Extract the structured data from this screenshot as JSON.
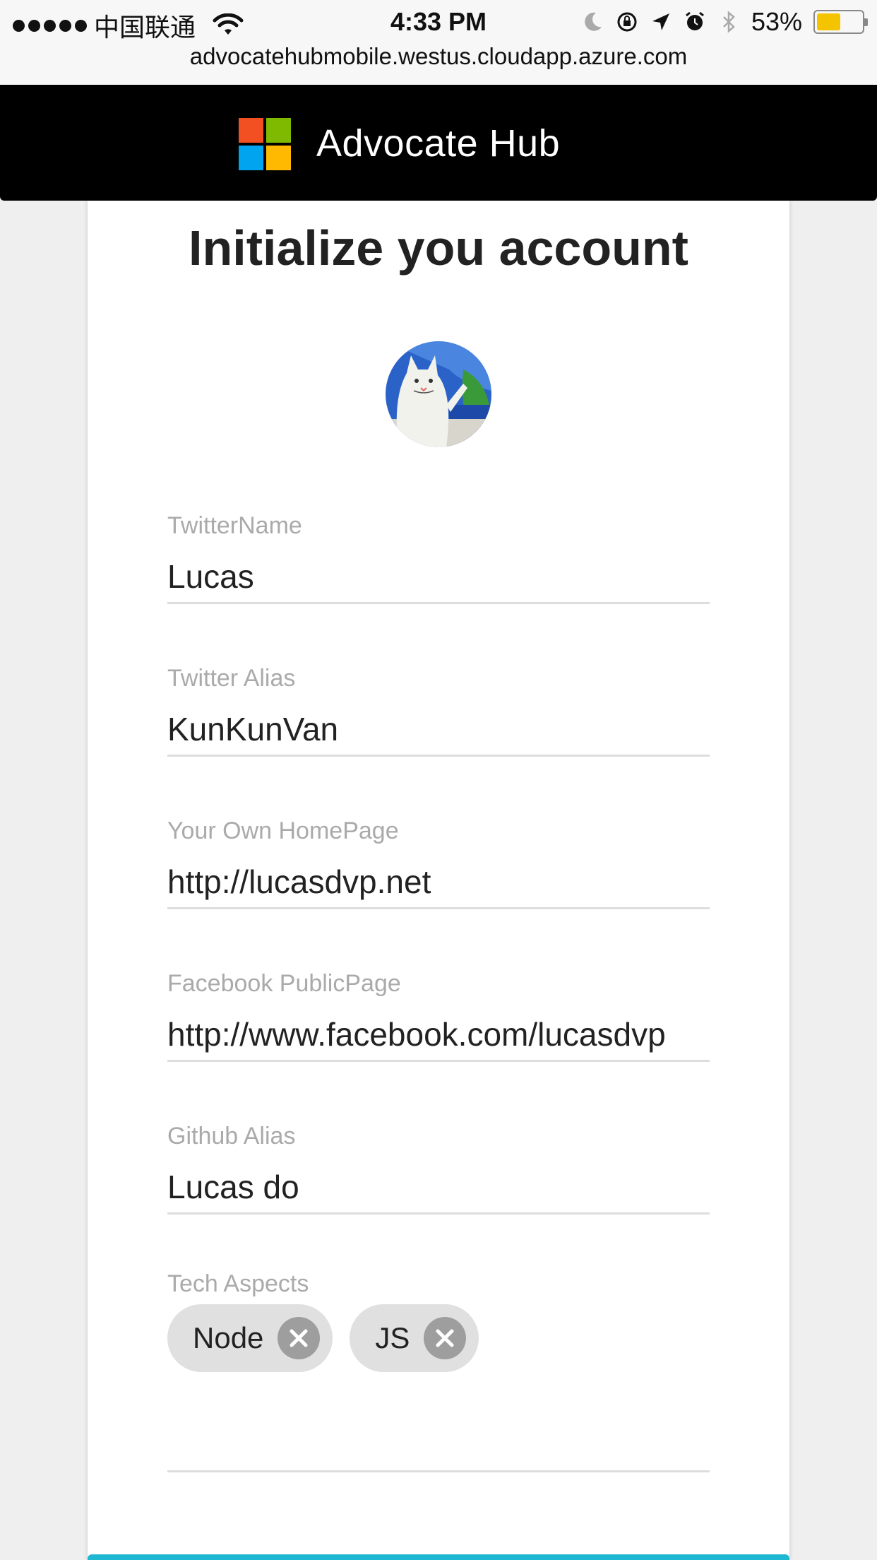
{
  "status_bar": {
    "carrier": "中国联通",
    "time": "4:33 PM",
    "battery_percent": "53%",
    "battery_level": 0.53,
    "icons": [
      "signal-dots-icon",
      "wifi-icon",
      "moon-icon",
      "rotation-lock-icon",
      "location-arrow-icon",
      "alarm-icon",
      "bluetooth-icon",
      "battery-icon"
    ]
  },
  "browser": {
    "url": "advocatehubmobile.westus.cloudapp.azure.com"
  },
  "header": {
    "title": "Advocate Hub",
    "logo_colors": [
      "#f25022",
      "#7fba00",
      "#00a4ef",
      "#ffb900"
    ]
  },
  "form": {
    "title": "Initialize you account",
    "fields": [
      {
        "label": "TwitterName",
        "value": "Lucas"
      },
      {
        "label": "Twitter Alias",
        "value": "KunKunVan"
      },
      {
        "label": "Your Own HomePage",
        "value": "http://lucasdvp.net"
      },
      {
        "label": "Facebook PublicPage",
        "value": "http://www.facebook.com/lucasdvp"
      },
      {
        "label": "Github Alias",
        "value": "Lucas do"
      }
    ],
    "tech_aspects": {
      "label": "Tech Aspects",
      "tags": [
        "Node",
        "JS"
      ]
    }
  },
  "colors": {
    "accent": "#1fb8d3",
    "header_bg": "#000000",
    "chip_bg": "#e0e0e0",
    "label_gray": "#aaaaaa"
  }
}
